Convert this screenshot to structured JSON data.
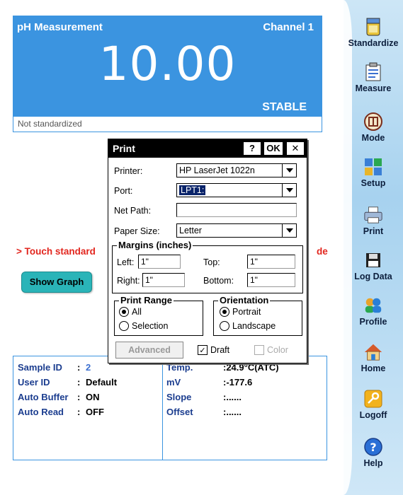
{
  "measurement": {
    "title": "pH Measurement",
    "channel": "Channel 1",
    "value": "10.00",
    "status": "STABLE",
    "standardization": "Not standardized"
  },
  "message": {
    "text": "> Touch standard",
    "tail": "de"
  },
  "show_graph_label": "Show Graph",
  "info": {
    "left": [
      {
        "label": "Sample ID",
        "sep": ":",
        "value": "2"
      },
      {
        "label": "User ID",
        "sep": ":",
        "value": "Default"
      },
      {
        "label": "Auto Buffer",
        "sep": ":",
        "value": "ON"
      },
      {
        "label": "Auto Read",
        "sep": ":",
        "value": "OFF"
      }
    ],
    "right": [
      {
        "label": "Temp.",
        "value": ":24.9°C(ATC)"
      },
      {
        "label": "mV",
        "value": ":-177.6"
      },
      {
        "label": "Slope",
        "value": ":......"
      },
      {
        "label": "Offset",
        "value": ":......"
      }
    ]
  },
  "toolbar": [
    {
      "label": "Standardize",
      "icon": "beaker-icon"
    },
    {
      "label": "Measure",
      "icon": "clipboard-icon"
    },
    {
      "label": "Mode",
      "icon": "mode-icon"
    },
    {
      "label": "Setup",
      "icon": "setup-icon"
    },
    {
      "label": "Print",
      "icon": "printer-icon"
    },
    {
      "label": "Log Data",
      "icon": "floppy-icon"
    },
    {
      "label": "Profile",
      "icon": "users-icon"
    },
    {
      "label": "Home",
      "icon": "home-icon"
    },
    {
      "label": "Logoff",
      "icon": "key-icon"
    },
    {
      "label": "Help",
      "icon": "help-icon"
    }
  ],
  "dialog": {
    "title": "Print",
    "help_btn": "?",
    "ok_btn": "OK",
    "close_btn": "✕",
    "printer_label": "Printer:",
    "printer_value": "HP LaserJet 1022n",
    "port_label": "Port:",
    "port_value": "LPT1:",
    "netpath_label": "Net Path:",
    "netpath_value": "",
    "paper_label": "Paper Size:",
    "paper_value": "Letter",
    "margins_title": "Margins (inches)",
    "left_label": "Left:",
    "left_value": "1\"",
    "top_label": "Top:",
    "top_value": "1\"",
    "right_label": "Right:",
    "right_value": "1\"",
    "bottom_label": "Bottom:",
    "bottom_value": "1\"",
    "range_title": "Print Range",
    "range_all": "All",
    "range_selection": "Selection",
    "orient_title": "Orientation",
    "orient_portrait": "Portrait",
    "orient_landscape": "Landscape",
    "advanced_btn": "Advanced",
    "draft_label": "Draft",
    "color_label": "Color"
  },
  "colors": {
    "panel_blue": "#3b94e0",
    "alert_red": "#e2261e",
    "graph_button": "#2ab4b8"
  }
}
